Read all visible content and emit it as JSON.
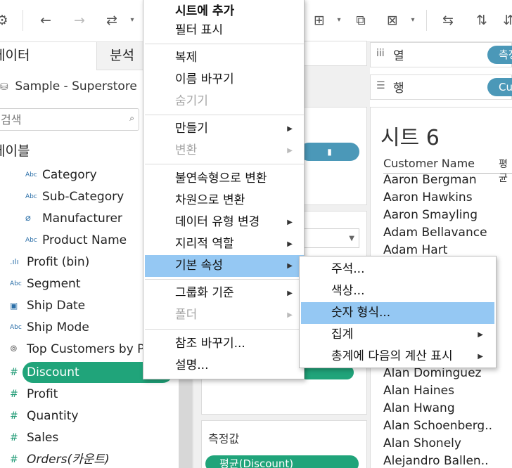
{
  "toolbar": {
    "icons": [
      "data-source-icon",
      "undo-icon",
      "redo-icon",
      "replay-icon",
      "dropdown-icon",
      "add-marks-icon",
      "dropdown-icon",
      "duplicate-icon",
      "clear-sheet-icon",
      "dropdown-icon",
      "swap-icon",
      "sort-ascending-icon",
      "sort-descending-icon"
    ]
  },
  "left_pane": {
    "tab_data": "데이터",
    "tab_analysis": "분석",
    "datasource": "Sample - Superstore",
    "search_placeholder": "검색",
    "tables_header": "테이블",
    "fields": [
      {
        "label": "Category",
        "icon": "Abc"
      },
      {
        "label": "Sub-Category",
        "icon": "Abc"
      },
      {
        "label": "Manufacturer",
        "icon": "paperclip"
      },
      {
        "label": "Product Name",
        "icon": "Abc"
      },
      {
        "label": "Profit (bin)",
        "icon": "bin"
      },
      {
        "label": "Segment",
        "icon": "Abc"
      },
      {
        "label": "Ship Date",
        "icon": "calendar"
      },
      {
        "label": "Ship Mode",
        "icon": "Abc"
      },
      {
        "label": "Top Customers by Profit",
        "icon": "set"
      },
      {
        "label": "Discount",
        "icon": "#"
      },
      {
        "label": "Profit",
        "icon": "#"
      },
      {
        "label": "Quantity",
        "icon": "#"
      },
      {
        "label": "Sales",
        "icon": "#"
      },
      {
        "label": "Orders(카운트)",
        "icon": "#"
      }
    ]
  },
  "middle": {
    "measure_header": "측정값",
    "measure_pill": "평균(Discount)"
  },
  "shelves": {
    "columns_label": "열",
    "columns_pill": "측정값",
    "rows_label": "행",
    "rows_pill": "Customer Name"
  },
  "view": {
    "sheet_title": "시트 6",
    "column_header": "Customer Name",
    "column_header2": "평균",
    "customers": [
      "Aaron Bergman",
      "Aaron Hawkins",
      "Aaron Smayling",
      "Adam Bellavance",
      "Adam Hart",
      "Alan Dominguez",
      "Alan Haines",
      "Alan Hwang",
      "Alan Schoenberg..",
      "Alan Shonely",
      "Alejandro Ballen.."
    ]
  },
  "context_menu": {
    "items": [
      {
        "label": "시트에 추가",
        "bold": true
      },
      {
        "label": "필터 표시"
      },
      {
        "label": "복제"
      },
      {
        "label": "이름 바꾸기"
      },
      {
        "label": "숨기기",
        "disabled": true
      },
      {
        "label": "만들기",
        "submenu": true
      },
      {
        "label": "변환",
        "submenu": true,
        "disabled": true
      },
      {
        "label": "불연속형으로 변환"
      },
      {
        "label": "차원으로 변환"
      },
      {
        "label": "데이터 유형 변경",
        "submenu": true
      },
      {
        "label": "지리적 역할",
        "submenu": true
      },
      {
        "label": "기본 속성",
        "submenu": true,
        "highlighted": true
      },
      {
        "label": "그룹화 기준",
        "submenu": true
      },
      {
        "label": "폴더",
        "submenu": true,
        "disabled": true
      },
      {
        "label": "참조 바꾸기..."
      },
      {
        "label": "설명..."
      }
    ]
  },
  "submenu": {
    "items": [
      {
        "label": "주석..."
      },
      {
        "label": "색상..."
      },
      {
        "label": "숫자 형식...",
        "highlighted": true
      },
      {
        "label": "집계",
        "submenu": true
      },
      {
        "label": "총계에 다음의 계산 표시",
        "submenu": true
      }
    ]
  },
  "colors": {
    "dimension_pill": "#4b98b8",
    "measure_pill": "#20a47a",
    "menu_highlight": "#95c8f3"
  }
}
